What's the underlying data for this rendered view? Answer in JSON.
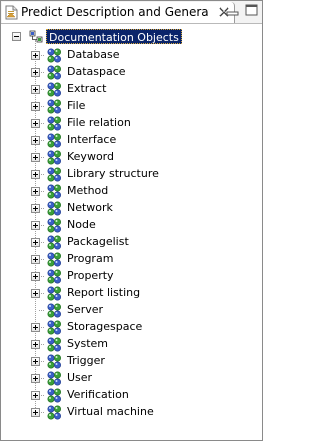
{
  "view": {
    "title": "Predict Description and Generati",
    "close_icon": "close-icon",
    "minimize_icon": "minimize-icon",
    "maximize_icon": "maximize-icon"
  },
  "tree": {
    "root_label": "Documentation Objects",
    "items": [
      {
        "label": "Database",
        "expandable": true
      },
      {
        "label": "Dataspace",
        "expandable": true
      },
      {
        "label": "Extract",
        "expandable": true
      },
      {
        "label": "File",
        "expandable": true
      },
      {
        "label": "File relation",
        "expandable": true
      },
      {
        "label": "Interface",
        "expandable": true
      },
      {
        "label": "Keyword",
        "expandable": true
      },
      {
        "label": "Library structure",
        "expandable": true
      },
      {
        "label": "Method",
        "expandable": true
      },
      {
        "label": "Network",
        "expandable": true
      },
      {
        "label": "Node",
        "expandable": true
      },
      {
        "label": "Packagelist",
        "expandable": true
      },
      {
        "label": "Program",
        "expandable": true
      },
      {
        "label": "Property",
        "expandable": true
      },
      {
        "label": "Report listing",
        "expandable": true
      },
      {
        "label": "Server",
        "expandable": false
      },
      {
        "label": "Storagespace",
        "expandable": true
      },
      {
        "label": "System",
        "expandable": true
      },
      {
        "label": "Trigger",
        "expandable": true
      },
      {
        "label": "User",
        "expandable": true
      },
      {
        "label": "Verification",
        "expandable": true
      },
      {
        "label": "Virtual machine",
        "expandable": true
      }
    ]
  },
  "colors": {
    "selection": "#0a246a",
    "node_blue": "#3a5fc8",
    "node_green": "#3aa03a"
  }
}
